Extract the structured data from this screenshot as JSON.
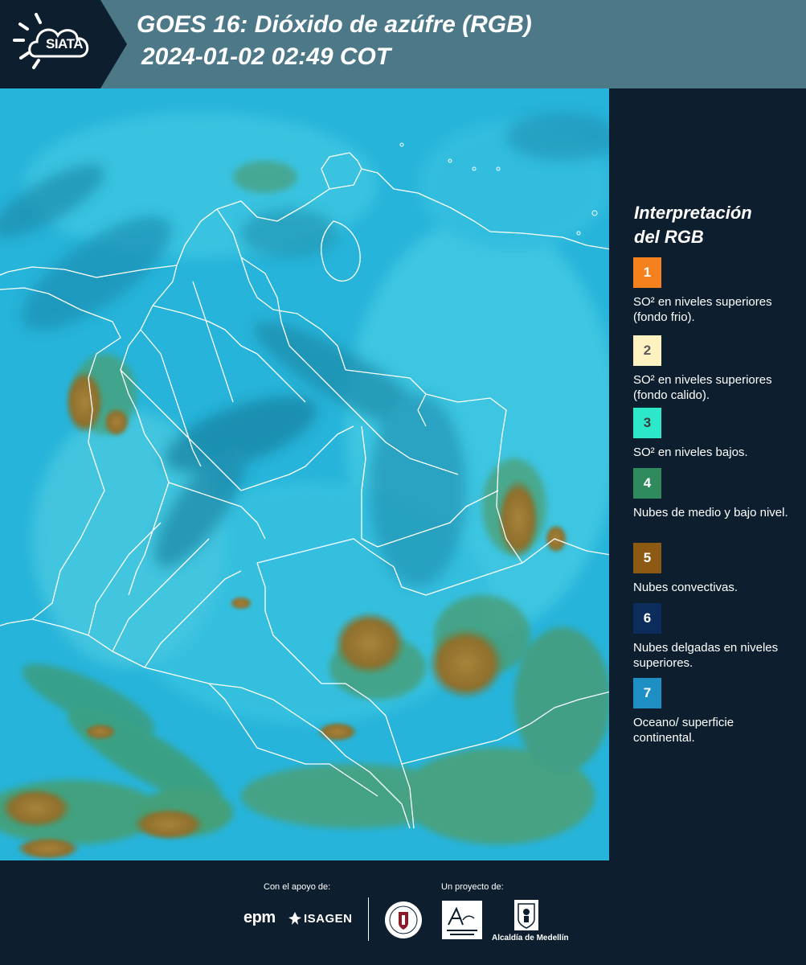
{
  "header": {
    "logo_text": "SIATA",
    "title_line1": "GOES 16: Dióxido de azúfre (RGB)",
    "title_line2": "2024-01-02 02:49 COT"
  },
  "legend": {
    "title_line1": "Interpretación",
    "title_line2": "del RGB",
    "items": [
      {
        "number": "1",
        "color": "#f5801e",
        "text_color": "#ffffff",
        "description": "SO² en niveles superiores (fondo frio)."
      },
      {
        "number": "2",
        "color": "#fdf2c0",
        "text_color": "#5a5a5a",
        "description": "SO² en niveles superiores (fondo calido)."
      },
      {
        "number": "3",
        "color": "#2de8c8",
        "text_color": "#3a3a3a",
        "description": "SO² en niveles bajos."
      },
      {
        "number": "4",
        "color": "#2f8a5e",
        "text_color": "#ffffff",
        "description": "Nubes de medio y bajo nivel."
      },
      {
        "number": "5",
        "color": "#8c5a12",
        "text_color": "#ffffff",
        "description": "Nubes convectivas."
      },
      {
        "number": "6",
        "color": "#0c2d5c",
        "text_color": "#ffffff",
        "description": "Nubes delgadas en niveles superiores."
      },
      {
        "number": "7",
        "color": "#1d8fc2",
        "text_color": "#ffffff",
        "description": "Oceano/ superficie continental."
      }
    ]
  },
  "footer": {
    "support_label": "Con el apoyo de:",
    "project_label": "Un proyecto de:",
    "sponsor_1": "epm",
    "sponsor_2": "ISAGEN",
    "partner_label": "Alcaldía de Medellín"
  },
  "colors": {
    "header_bg": "#4d7888",
    "panel_bg": "#0d1f2e",
    "map_base": "#28b6dc"
  }
}
